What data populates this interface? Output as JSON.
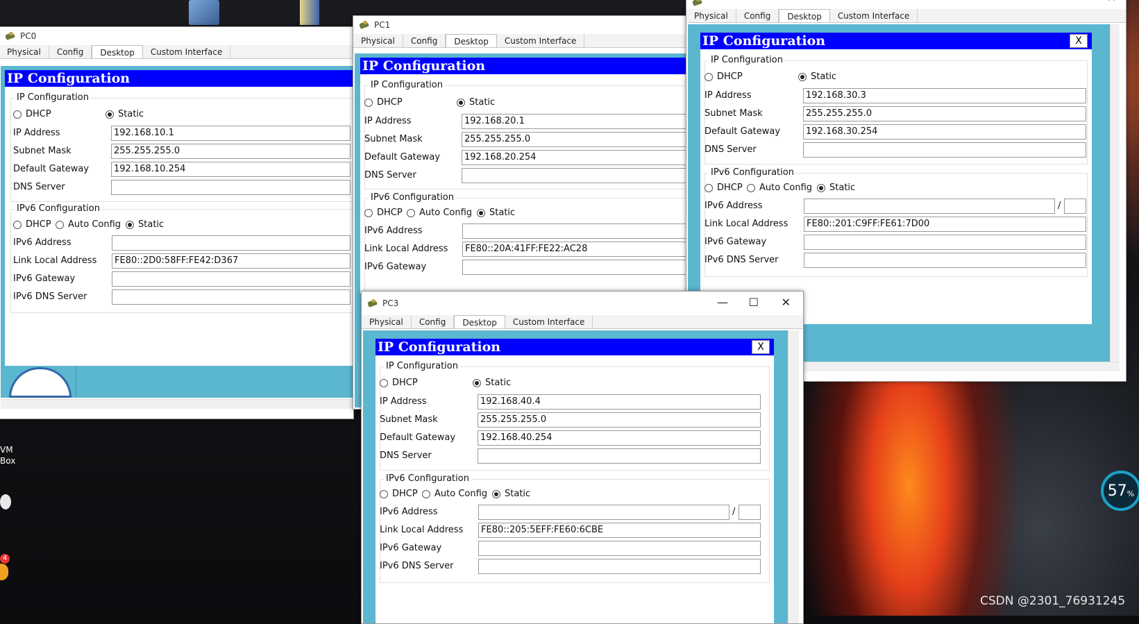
{
  "desktop": {
    "icons": [
      {
        "label": "VM\nBox"
      },
      {
        "label": "4"
      }
    ],
    "watermark": "CSDN @2301_76931245",
    "gauge": "57",
    "gauge_unit": "%"
  },
  "tabs": [
    "Physical",
    "Config",
    "Desktop",
    "Custom Interface"
  ],
  "labels": {
    "ip_config_header": "IP Configuration",
    "ip_config_group": "IP Configuration",
    "ipv6_group": "IPv6 Configuration",
    "dhcp": "DHCP",
    "static": "Static",
    "auto_config": "Auto Config",
    "ip_address": "IP Address",
    "subnet_mask": "Subnet Mask",
    "default_gateway": "Default Gateway",
    "dns_server": "DNS Server",
    "ipv6_address": "IPv6 Address",
    "link_local": "Link Local Address",
    "ipv6_gateway": "IPv6 Gateway",
    "ipv6_dns": "IPv6 DNS Server",
    "close_x": "X",
    "slash": "/"
  },
  "pc0": {
    "title": "PC0",
    "ip": "192.168.10.1",
    "mask": "255.255.255.0",
    "gateway": "192.168.10.254",
    "dns": "",
    "ipv6": "",
    "link_local": "FE80::2D0:58FF:FE42:D367",
    "ipv6_gw": "",
    "ipv6_dns": ""
  },
  "pc1": {
    "title": "PC1",
    "ip": "192.168.20.1",
    "mask": "255.255.255.0",
    "gateway": "192.168.20.254",
    "dns": "",
    "ipv6": "",
    "link_local": "FE80::20A:41FF:FE22:AC28",
    "ipv6_gw": ""
  },
  "pc2": {
    "ip": "192.168.30.3",
    "mask": "255.255.255.0",
    "gateway": "192.168.30.254",
    "dns": "",
    "ipv6": "",
    "link_local": "FE80::201:C9FF:FE61:7D00",
    "ipv6_gw": "",
    "ipv6_dns": ""
  },
  "pc3": {
    "title": "PC3",
    "ip": "192.168.40.4",
    "mask": "255.255.255.0",
    "gateway": "192.168.40.254",
    "dns": "",
    "ipv6": "",
    "link_local": "FE80::205:5EFF:FE60:6CBE",
    "ipv6_gw": "",
    "ipv6_dns": ""
  }
}
